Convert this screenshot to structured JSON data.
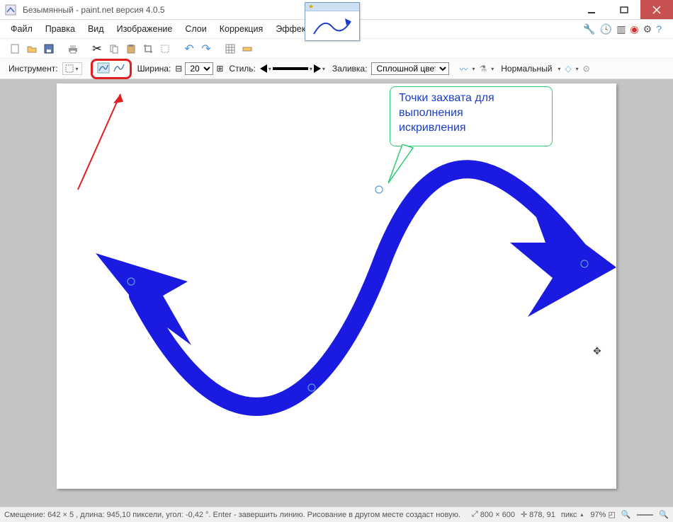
{
  "window": {
    "title": "Безымянный - paint.net версия 4.0.5"
  },
  "menu": {
    "file": "Файл",
    "edit": "Правка",
    "view": "Вид",
    "image": "Изображение",
    "layers": "Слои",
    "adjustments": "Коррекция",
    "effects": "Эффекты"
  },
  "toolbar": {
    "tool_label": "Инструмент:",
    "width_label": "Ширина:",
    "width_value": "20",
    "style_label": "Стиль:",
    "fill_label": "Заливка:",
    "fill_value": "Сплошной цвет",
    "blend_label": "Нормальный"
  },
  "annotation": {
    "callout_line1": "Точки захвата для",
    "callout_line2": "выполнения",
    "callout_line3": "искривления"
  },
  "status": {
    "offset_text": "Смещение: 642 × 5 , длина: 945,10 пиксели, угол: -0,42 °. Enter - завершить линию. Рисование в другом месте создаст новую.",
    "canvas_size": "800 × 600",
    "cursor_pos": "878, 91",
    "units": "пикс",
    "zoom": "97%"
  },
  "colors": {
    "curve_blue": "#1a1ae0",
    "highlight_red": "#e02020",
    "callout_green": "#2ecc71",
    "callout_text": "#1a3dcc"
  }
}
